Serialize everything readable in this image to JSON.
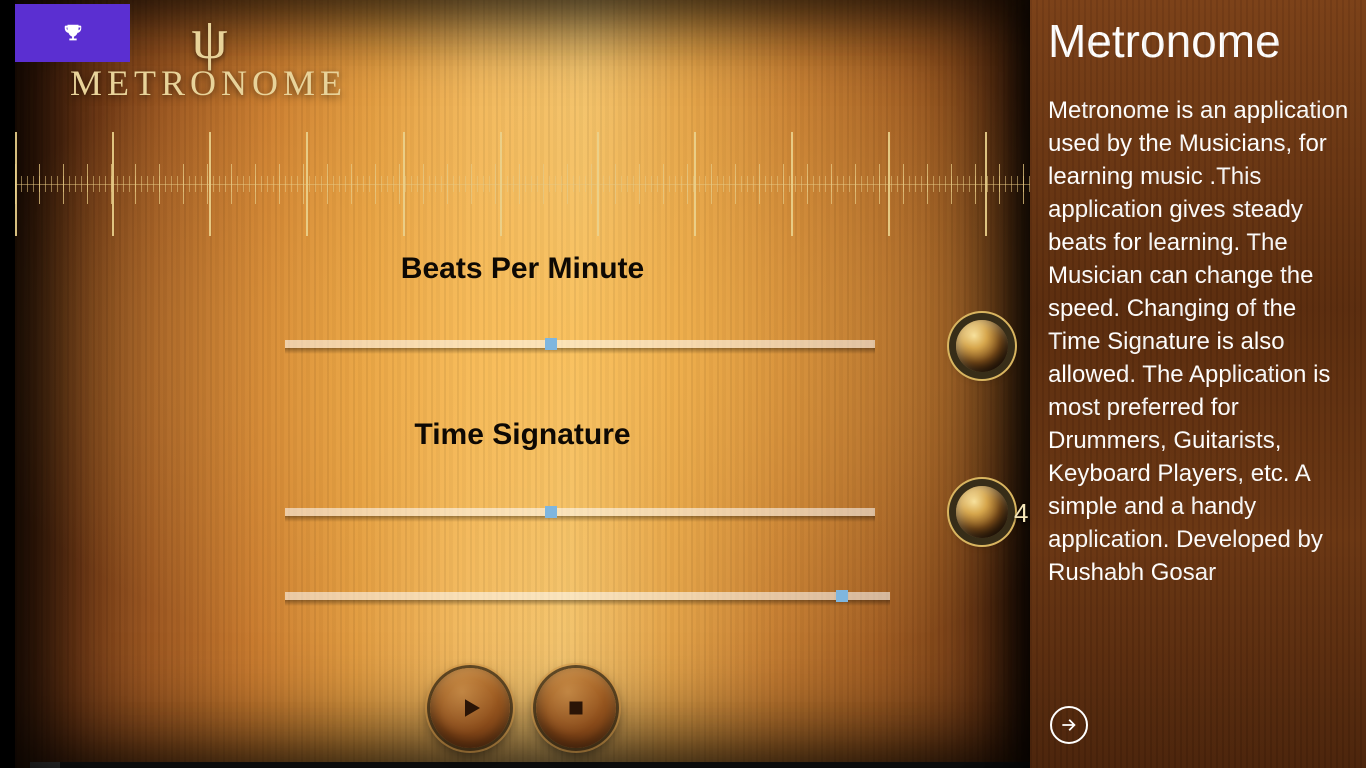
{
  "logo": {
    "text": "METRONOME"
  },
  "labels": {
    "bpm": "Beats Per Minute",
    "time_signature": "Time Signature"
  },
  "sliders": {
    "bpm_pct": 45,
    "ts1_pct": 45,
    "ts2_pct": 92
  },
  "knobs": {
    "bpm_value": "",
    "ts_value": "4"
  },
  "side": {
    "title": "Metronome",
    "body": "Metronome is an application used by the Musicians, for learning music .This application gives steady beats for learning. The Musician can change the speed. Changing of the Time Signature is also allowed. The Application is most preferred for Drummers, Guitarists, Keyboard Players, etc. A simple and a handy application. Developed by Rushabh Gosar"
  }
}
